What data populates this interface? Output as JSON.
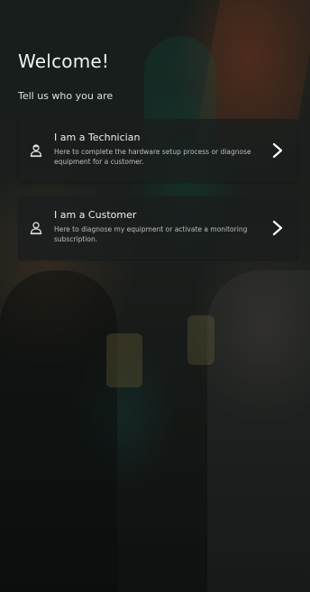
{
  "page": {
    "title": "Welcome!",
    "subtitle": "Tell us who you are"
  },
  "roles": [
    {
      "label": "I am a Technician",
      "description": "Here to complete the hardware setup process or diagnose equipment for a customer.",
      "icon": "technician-user-icon"
    },
    {
      "label": "I am a Customer",
      "description": "Here to diagnose my equipment or activate a monitoring subscription.",
      "icon": "customer-user-icon"
    }
  ],
  "colors": {
    "card_bg": "#1a1e1d",
    "text_primary": "#f0f0f0",
    "text_secondary": "#bdbdbd"
  }
}
